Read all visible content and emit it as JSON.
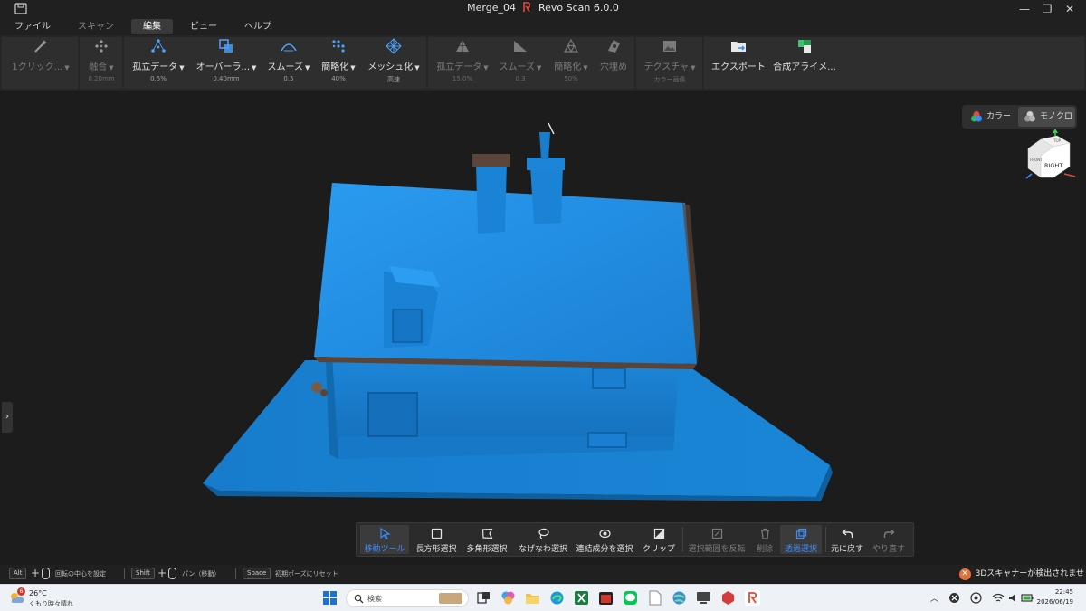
{
  "window": {
    "file_name": "Merge_04",
    "app_name": "Revo Scan 6.0.0",
    "minimize": "—",
    "maximize": "❐",
    "close": "✕"
  },
  "menu": {
    "items": [
      "ファイル",
      "スキャン",
      "編集",
      "ビュー",
      "ヘルプ"
    ],
    "active": "編集"
  },
  "toolbar": {
    "one_click": {
      "label": "1クリック..."
    },
    "fusion": {
      "label": "融合",
      "value": "0.20mm"
    },
    "isolated": {
      "label": "孤立データ",
      "value": "0.5%"
    },
    "overlap": {
      "label": "オーバーラ...",
      "value": "0.40mm"
    },
    "smooth": {
      "label": "スムーズ",
      "value": "0.5"
    },
    "simplify": {
      "label": "簡略化",
      "value": "40%"
    },
    "mesh": {
      "label": "メッシュ化",
      "value": "高速"
    },
    "mesh_isolated": {
      "label": "孤立データ",
      "value": "15.0%"
    },
    "mesh_smooth": {
      "label": "スムーズ",
      "value": "0.3"
    },
    "mesh_simplify": {
      "label": "簡略化",
      "value": "50%"
    },
    "fill_holes": {
      "label": "穴埋め"
    },
    "texture": {
      "label": "テクスチャ",
      "value": "カラー画像"
    },
    "export": {
      "label": "エクスポート"
    },
    "align": {
      "label": "合成アライメ..."
    }
  },
  "view_mode": {
    "color": "カラー",
    "mono": "モノクロ",
    "selected": "mono"
  },
  "view_cube": {
    "face_right": "RIGHT",
    "face_top": "TOP",
    "face_front": "FRONT"
  },
  "palette": {
    "move": "移動ツール",
    "rect": "長方形選択",
    "poly": "多角形選択",
    "lasso": "なげなわ選択",
    "connected": "連結成分を選択",
    "clip": "クリップ",
    "invert": "選択範囲を反転",
    "delete": "削除",
    "through": "透過選択",
    "undo": "元に戻す",
    "redo": "やり直す"
  },
  "status": {
    "key_alt": "Alt",
    "hint_rotate": "回転の中心を設定",
    "key_shift": "Shift",
    "hint_pan": "パン（移動）",
    "key_space": "Space",
    "hint_reset": "初期ポーズにリセット",
    "notice": "3Dスキャナーが検出されませ"
  },
  "taskbar": {
    "weather_badge": "6",
    "temperature": "26°C",
    "weather": "くもり時々晴れ",
    "search_placeholder": "検索",
    "time": "22:45",
    "date": "2026/06/19"
  },
  "colors": {
    "mesh_blue": "#1e8de0",
    "accent_blue": "#3b8bff",
    "notice_orange": "#e2703a"
  }
}
